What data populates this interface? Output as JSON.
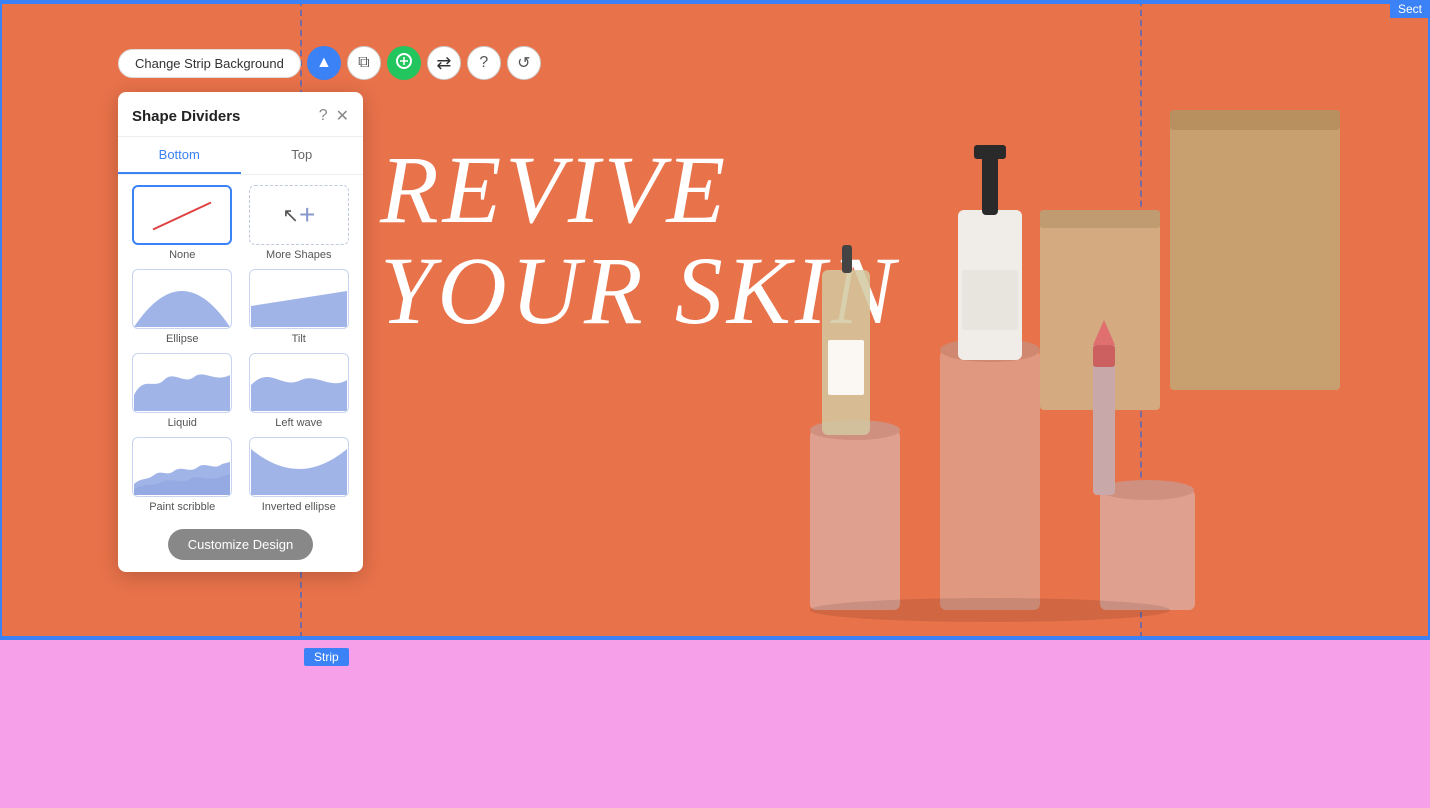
{
  "topBorder": {
    "color": "#3b82f6"
  },
  "sectionLabel": "Sect",
  "toolbar": {
    "changeBgLabel": "Change Strip Background",
    "icons": [
      {
        "name": "arrow-up-icon",
        "symbol": "▲",
        "style": "blue"
      },
      {
        "name": "copy-icon",
        "symbol": "⧉",
        "style": "gray-outline"
      },
      {
        "name": "crop-icon",
        "symbol": "⊞",
        "style": "green"
      },
      {
        "name": "swap-icon",
        "symbol": "⇄",
        "style": "arrow-icon"
      },
      {
        "name": "help-icon",
        "symbol": "?",
        "style": "gray-outline"
      },
      {
        "name": "more-icon",
        "symbol": "↺",
        "style": "gray-outline"
      }
    ]
  },
  "panel": {
    "title": "Shape Dividers",
    "tabs": [
      {
        "label": "Bottom",
        "active": true
      },
      {
        "label": "Top",
        "active": false
      }
    ],
    "shapes": [
      {
        "id": "none",
        "label": "None",
        "selected": true
      },
      {
        "id": "more",
        "label": "More Shapes",
        "isAdd": true
      },
      {
        "id": "ellipse",
        "label": "Ellipse"
      },
      {
        "id": "tilt",
        "label": "Tilt"
      },
      {
        "id": "liquid",
        "label": "Liquid"
      },
      {
        "id": "left-wave",
        "label": "Left wave"
      },
      {
        "id": "paint-scribble",
        "label": "Paint scribble"
      },
      {
        "id": "inverted-ellipse",
        "label": "Inverted ellipse"
      }
    ],
    "customizeLabel": "Customize Design"
  },
  "stripLabel": "Strip",
  "hero": {
    "line1": "REVIVE",
    "line2": "YOUR SKIN"
  }
}
